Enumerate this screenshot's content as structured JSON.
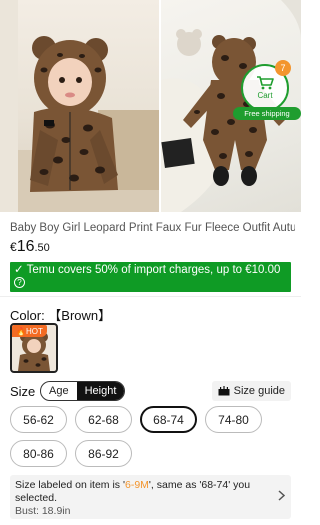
{
  "gallery": {
    "cart": {
      "label": "Cart",
      "count": "7",
      "shipping_label": "Free shipping",
      "icon": "cart-icon"
    }
  },
  "product": {
    "title": "Baby Boy Girl Leopard Print Faux Fur Fleece Outfit Autu...",
    "price": {
      "currency": "€",
      "whole": "16",
      "cents": ".50"
    }
  },
  "promo": {
    "text": "✓ Temu covers 50% of import charges, up to €10.00",
    "help_icon": "question-icon",
    "help_glyph": "?",
    "color": "#0f9b25"
  },
  "color_section": {
    "label": "Color: 【Brown】",
    "badge": "🔥HOT"
  },
  "size_section": {
    "label": "Size",
    "toggle": [
      "Age",
      "Height"
    ],
    "active_toggle": "Height",
    "guide_label": "Size guide",
    "options": [
      "56-62",
      "62-68",
      "68-74",
      "74-80",
      "80-86",
      "86-92"
    ],
    "selected": "68-74"
  },
  "size_info": {
    "prefix": "Size labeled on item is '",
    "highlight": "6-9M",
    "suffix": "', same as '68-74' you selected.",
    "bust": "Bust: 18.9in"
  }
}
